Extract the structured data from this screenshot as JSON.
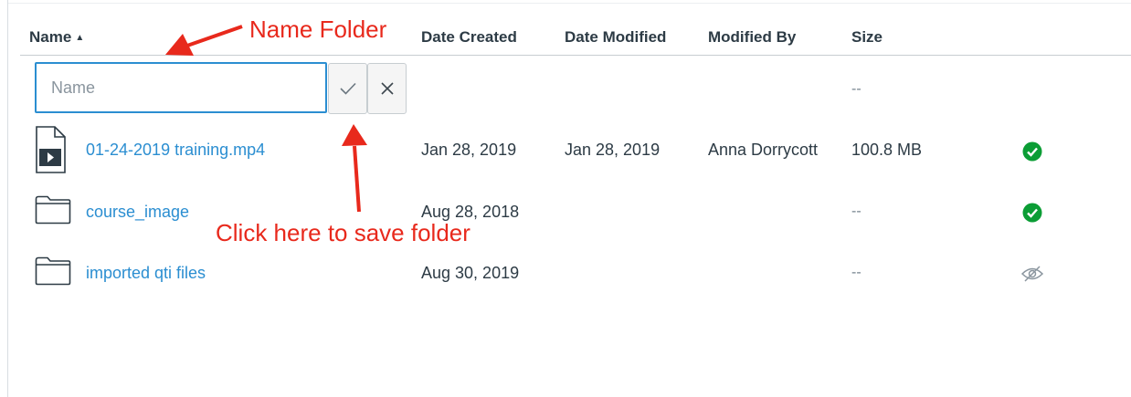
{
  "columns": {
    "name": "Name",
    "name_sort": "▲",
    "date_created": "Date Created",
    "date_modified": "Date Modified",
    "modified_by": "Modified By",
    "size": "Size"
  },
  "new_folder": {
    "placeholder": "Name",
    "value": "",
    "save_icon": "checkmark-icon",
    "cancel_icon": "close-icon",
    "size": "--"
  },
  "rows": [
    {
      "icon": "video-file-icon",
      "name": "01-24-2019 training.mp4",
      "date_created": "Jan 28, 2019",
      "date_modified": "Jan 28, 2019",
      "modified_by": "Anna Dorrycott",
      "size": "100.8 MB",
      "status_icon": "published-check-icon",
      "status_color": "#0b9d35"
    },
    {
      "icon": "folder-icon",
      "name": "course_image",
      "date_created": "Aug 28, 2018",
      "date_modified": "",
      "modified_by": "",
      "size": "--",
      "status_icon": "published-check-icon",
      "status_color": "#0b9d35"
    },
    {
      "icon": "folder-icon",
      "name": "imported qti files",
      "date_created": "Aug 30, 2019",
      "date_modified": "",
      "modified_by": "",
      "size": "--",
      "status_icon": "hidden-eye-icon",
      "status_color": "#8a959e"
    }
  ],
  "annotations": {
    "name_folder": "Name Folder",
    "save_folder": "Click here to save folder",
    "color": "#e8291c"
  },
  "colors": {
    "link": "#2b8ed1",
    "focus": "#2b8ed1",
    "text": "#2d3b45"
  }
}
